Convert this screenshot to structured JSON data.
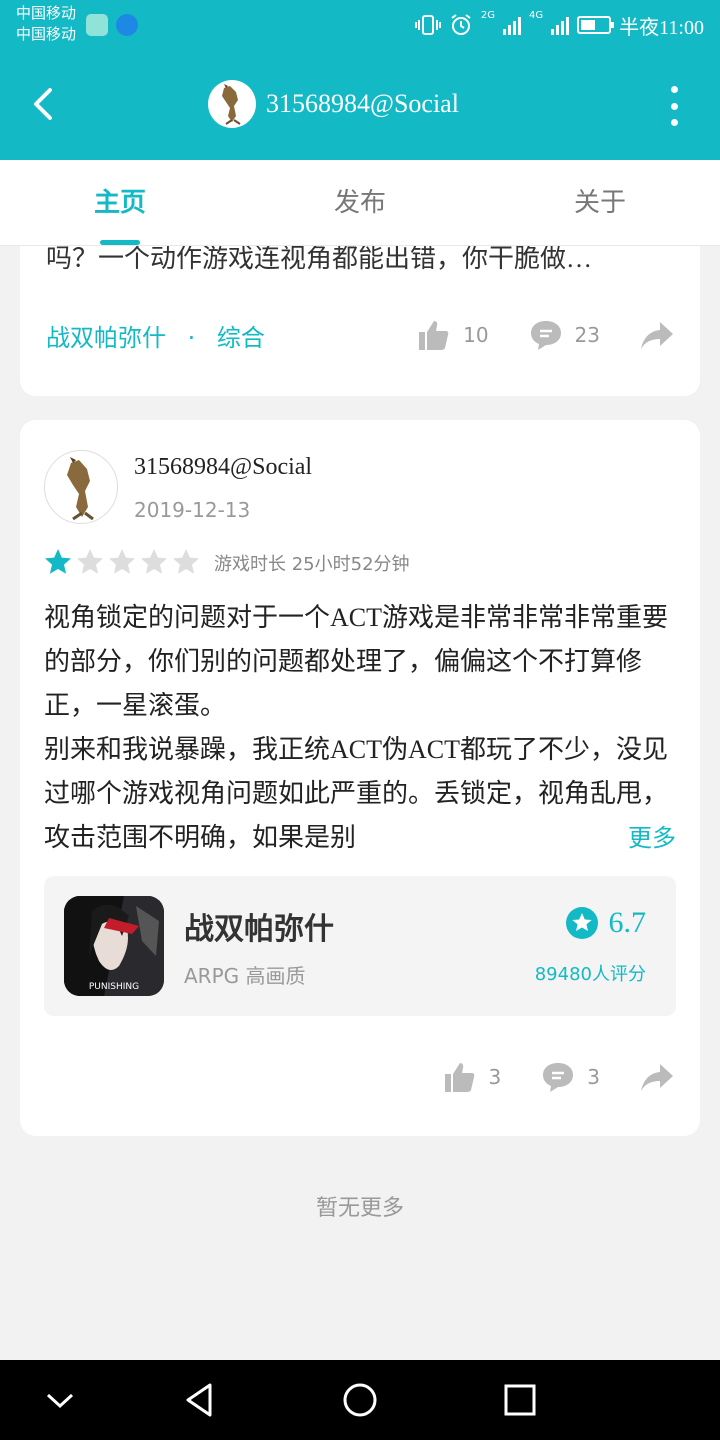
{
  "status_bar": {
    "carrier_1": "中国移动",
    "carrier_2": "中国移动",
    "network_1": "2G",
    "network_2": "4G",
    "time": "半夜11:00",
    "battery_level": 0.55
  },
  "app_bar": {
    "title": "31568984@Social",
    "accent_color": "#14b9c6"
  },
  "tabs": [
    {
      "label": "主页",
      "active": true
    },
    {
      "label": "发布",
      "active": false
    },
    {
      "label": "关于",
      "active": false
    }
  ],
  "previous_post": {
    "text_fragment": "吗？一个动作游戏连视角都能出错，你干脆做…",
    "game": "战双帕弥什",
    "separator": "·",
    "category": "综合",
    "likes": "10",
    "comments": "23"
  },
  "review": {
    "author": "31568984@Social",
    "date": "2019-12-13",
    "rating": 1,
    "max_rating": 5,
    "playtime": "游戏时长 25小时52分钟",
    "text": "视角锁定的问题对于一个ACT游戏是非常非常非常重要的部分，你们别的问题都处理了，偏偏这个不打算修正，一星滚蛋。\n别来和我说暴躁，我正统ACT伪ACT都玩了不少，没见过哪个游戏视角问题如此严重的。丢锁定，视角乱甩，攻击范围不明确，如果是别",
    "more_label": "更多",
    "likes": "3",
    "comments": "3"
  },
  "game_card": {
    "name": "战双帕弥什",
    "genre": "ARPG   高画质",
    "score": "6.7",
    "rating_count": "89480人评分",
    "icon_text": "PUNISHING"
  },
  "footer": {
    "no_more": "暂无更多"
  }
}
